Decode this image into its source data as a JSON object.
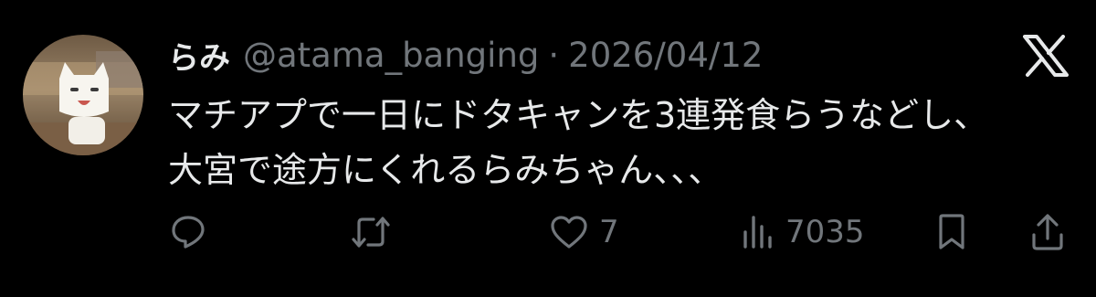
{
  "tweet": {
    "author": {
      "display_name": "らみ",
      "handle": "@atama_banging",
      "avatar": "toro-cat-avatar"
    },
    "separator": "·",
    "date": "2026/04/12",
    "platform_logo": "x-logo",
    "text_lines": [
      "マチアプで一日にドタキャンを3連発食らうなどし、",
      "大宮で途方にくれるらみちゃん、、、"
    ]
  },
  "actions": {
    "reply": {
      "icon": "reply-icon"
    },
    "retweet": {
      "icon": "retweet-icon"
    },
    "like": {
      "icon": "heart-icon",
      "count": "7"
    },
    "views": {
      "icon": "views-icon",
      "count": "7035"
    },
    "bookmark": {
      "icon": "bookmark-icon"
    },
    "share": {
      "icon": "share-icon"
    }
  },
  "colors": {
    "background": "#000000",
    "primary_text": "#e7e9ea",
    "secondary_text": "#71767b"
  }
}
